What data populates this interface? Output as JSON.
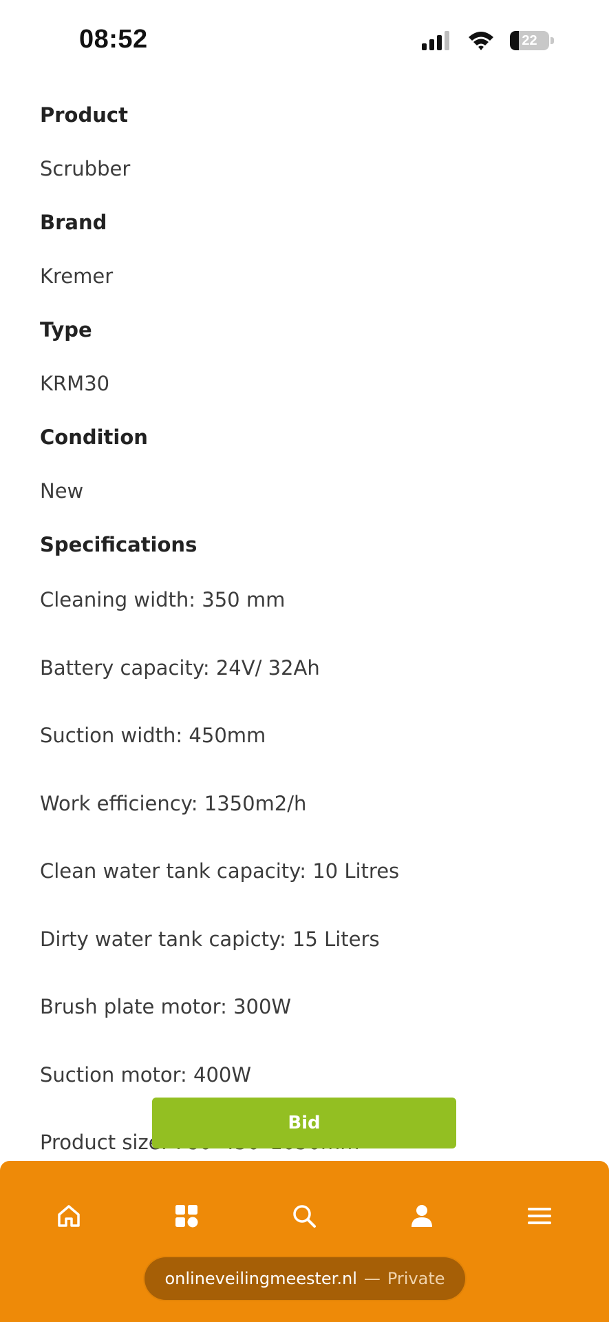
{
  "status_bar": {
    "time": "08:52",
    "battery_level": "22",
    "icons": [
      "signal-icon",
      "wifi-icon",
      "battery-icon"
    ]
  },
  "details": {
    "product_label": "Product",
    "product_value": "Scrubber",
    "brand_label": "Brand",
    "brand_value": "Kremer",
    "type_label": "Type",
    "type_value": "KRM30",
    "condition_label": "Condition",
    "condition_value": "New",
    "specifications_label": "Specifications",
    "specs": [
      "Cleaning width: 350 mm",
      "Battery capacity: 24V/ 32Ah",
      "Suction width: 450mm",
      "Work efficiency: 1350m2/h",
      "Clean water tank capacity: 10 Litres",
      "Dirty water tank capicty: 15 Liters",
      "Brush plate motor: 300W",
      "Suction motor: 400W",
      "Product size: 780*450*1050mm"
    ]
  },
  "bid_button": {
    "label": "Bid"
  },
  "bottom_nav": {
    "items": [
      "home-icon",
      "categories-icon",
      "search-icon",
      "account-icon",
      "menu-icon"
    ]
  },
  "browser": {
    "domain": "onlineveilingmeester.nl",
    "separator": "—",
    "mode": "Private"
  },
  "colors": {
    "accent_orange": "#ee8a08",
    "bid_green": "#93bf22",
    "pill_brown": "#a65f06"
  }
}
